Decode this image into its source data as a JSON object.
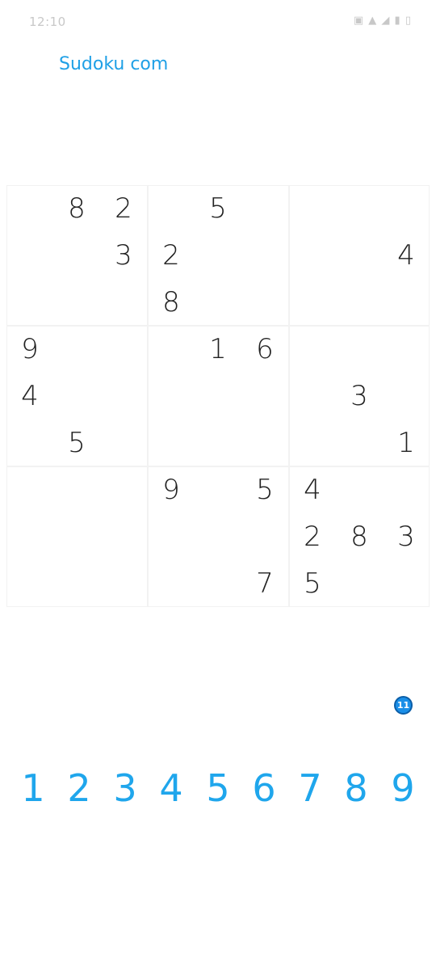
{
  "status_bar": {
    "time": "12:10",
    "icons": "▣ ▲ ◢ ▮ ▯"
  },
  "app_title": "Sudoku com",
  "board": {
    "rows": [
      [
        "",
        "8",
        "2",
        "",
        "5",
        "",
        "",
        "",
        ""
      ],
      [
        "",
        "",
        "3",
        "2",
        "",
        "",
        "",
        "",
        "4"
      ],
      [
        "",
        "",
        "",
        "8",
        "",
        "",
        "",
        "",
        ""
      ],
      [
        "9",
        "",
        "",
        "",
        "1",
        "6",
        "",
        "",
        ""
      ],
      [
        "4",
        "",
        "",
        "",
        "",
        "",
        "",
        "3",
        ""
      ],
      [
        "",
        "5",
        "",
        "",
        "",
        "",
        "",
        "",
        "1"
      ],
      [
        "",
        "",
        "",
        "9",
        "",
        "5",
        "4",
        "",
        ""
      ],
      [
        "",
        "",
        "",
        "",
        "",
        "",
        "2",
        "8",
        "3"
      ],
      [
        "",
        "",
        "",
        "",
        "",
        "7",
        "5",
        "",
        ""
      ]
    ]
  },
  "badge": "11",
  "numpad": [
    "1",
    "2",
    "3",
    "4",
    "5",
    "6",
    "7",
    "8",
    "9"
  ],
  "colors": {
    "accent": "#1fa6ec",
    "badge": "#1a8fe8",
    "digit": "#222222",
    "grid_line": "#f2f2f2"
  }
}
